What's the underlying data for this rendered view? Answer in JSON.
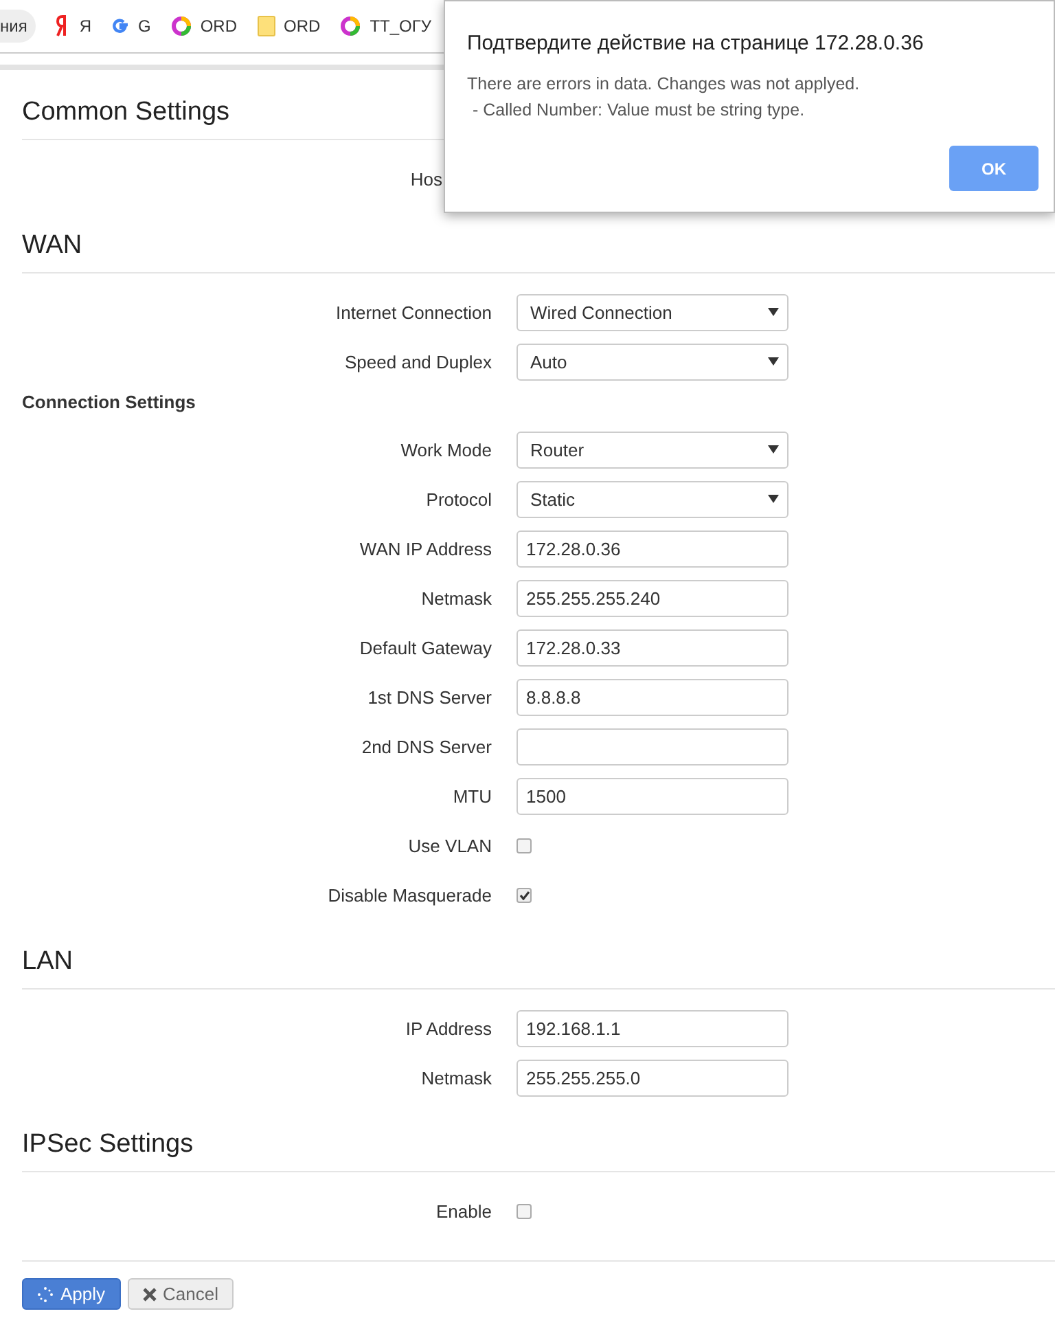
{
  "bookmarks_bar": {
    "items": [
      {
        "kind": "pill",
        "label": "ния"
      },
      {
        "kind": "yandex",
        "label": "Я"
      },
      {
        "kind": "google",
        "label": "G"
      },
      {
        "kind": "ring",
        "label": "ORD"
      },
      {
        "kind": "folder",
        "label": "ORD"
      },
      {
        "kind": "ring",
        "label": "TT_ОГУ"
      }
    ]
  },
  "sections": [
    {
      "title": "Common Settings",
      "rows": [
        {
          "kind": "covered",
          "label": "Hos"
        }
      ]
    },
    {
      "title": "WAN",
      "rows": [
        {
          "kind": "select",
          "label": "Internet Connection",
          "value": "Wired Connection"
        },
        {
          "kind": "select",
          "label": "Speed and Duplex",
          "value": "Auto"
        },
        {
          "kind": "subheading",
          "label": "Connection Settings"
        },
        {
          "kind": "select",
          "label": "Work Mode",
          "value": "Router"
        },
        {
          "kind": "select",
          "label": "Protocol",
          "value": "Static"
        },
        {
          "kind": "text",
          "label": "WAN IP Address",
          "value": "172.28.0.36"
        },
        {
          "kind": "text",
          "label": "Netmask",
          "value": "255.255.255.240"
        },
        {
          "kind": "text",
          "label": "Default Gateway",
          "value": "172.28.0.33"
        },
        {
          "kind": "text",
          "label": "1st DNS Server",
          "value": "8.8.8.8"
        },
        {
          "kind": "text",
          "label": "2nd DNS Server",
          "value": ""
        },
        {
          "kind": "text",
          "label": "MTU",
          "value": "1500"
        },
        {
          "kind": "checkbox",
          "label": "Use VLAN",
          "checked": false
        },
        {
          "kind": "checkbox",
          "label": "Disable Masquerade",
          "checked": true
        }
      ]
    },
    {
      "title": "LAN",
      "rows": [
        {
          "kind": "text",
          "label": "IP Address",
          "value": "192.168.1.1"
        },
        {
          "kind": "text",
          "label": "Netmask",
          "value": "255.255.255.0"
        }
      ]
    },
    {
      "title": "IPSec Settings",
      "rows": [
        {
          "kind": "checkbox",
          "label": "Enable",
          "checked": false
        }
      ]
    }
  ],
  "buttons": [
    {
      "kind": "primary",
      "label": "Apply"
    },
    {
      "kind": "cancel",
      "label": "Cancel"
    }
  ],
  "dialog": {
    "title": "Подтвердите действие на странице 172.28.0.36",
    "lines": [
      "There are errors in data. Changes was not applyed.",
      "- Called Number: Value must be string type."
    ],
    "button": "OK"
  }
}
